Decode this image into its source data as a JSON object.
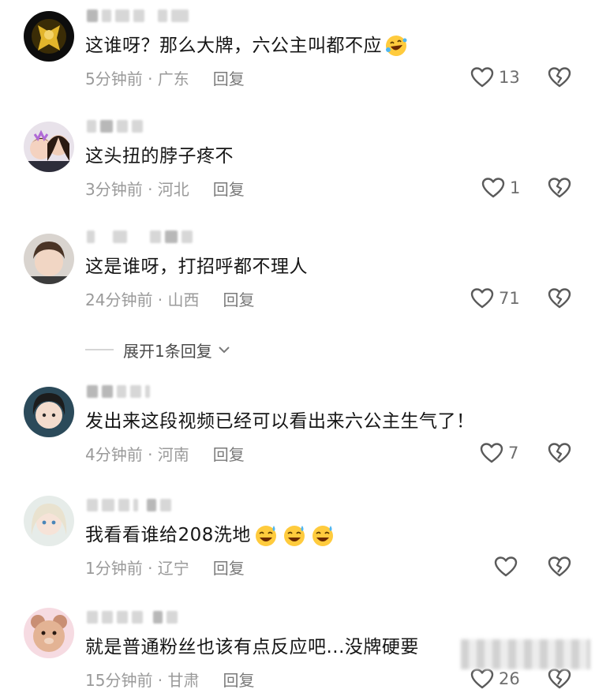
{
  "comments": [
    {
      "text": "这谁呀？那么大牌，六公主叫都不应",
      "emoji": "rolling-laugh",
      "time_location": "5分钟前 · 广东",
      "reply_label": "回复",
      "likes": "13"
    },
    {
      "text": "这头扭的脖子疼不",
      "emoji": "",
      "time_location": "3分钟前 · 河北",
      "reply_label": "回复",
      "likes": "1"
    },
    {
      "text": "这是谁呀，打招呼都不理人",
      "emoji": "",
      "time_location": "24分钟前 · 山西",
      "reply_label": "回复",
      "likes": "71"
    },
    {
      "text": "发出来这段视频已经可以看出来六公主生气了！",
      "emoji": "",
      "time_location": "4分钟前 · 河南",
      "reply_label": "回复",
      "likes": "7"
    },
    {
      "text": "我看看谁给208洗地",
      "emoji": "sweat-smile x3",
      "time_location": "1分钟前 · 辽宁",
      "reply_label": "回复",
      "likes": ""
    },
    {
      "text": "就是普通粉丝也该有点反应吧...没牌硬要",
      "emoji": "",
      "time_location": "15分钟前 · 甘肃",
      "reply_label": "回复",
      "likes": "26"
    }
  ],
  "expand_replies": {
    "label": "展开1条回复"
  },
  "icons": {
    "like": "heart-outline-icon",
    "dislike": "broken-heart-icon",
    "expand": "chevron-down-icon"
  },
  "colors": {
    "text": "#161616",
    "meta": "#9a9a9a",
    "icon": "#5a5a5a"
  }
}
